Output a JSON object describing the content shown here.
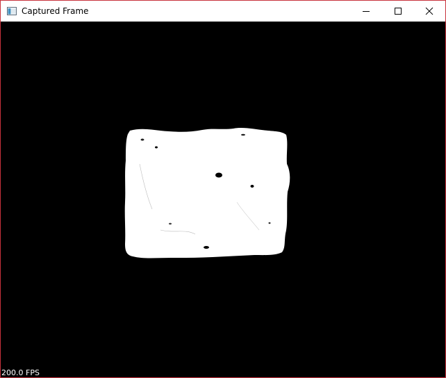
{
  "window": {
    "title": "Captured Frame",
    "controls": {
      "minimize": "minimize-icon",
      "maximize": "maximize-icon",
      "close": "close-icon"
    },
    "border_color": "#c8323c"
  },
  "frame": {
    "background": "#000000",
    "blob_color": "#ffffff",
    "fps_label": "200.0 FPS"
  }
}
